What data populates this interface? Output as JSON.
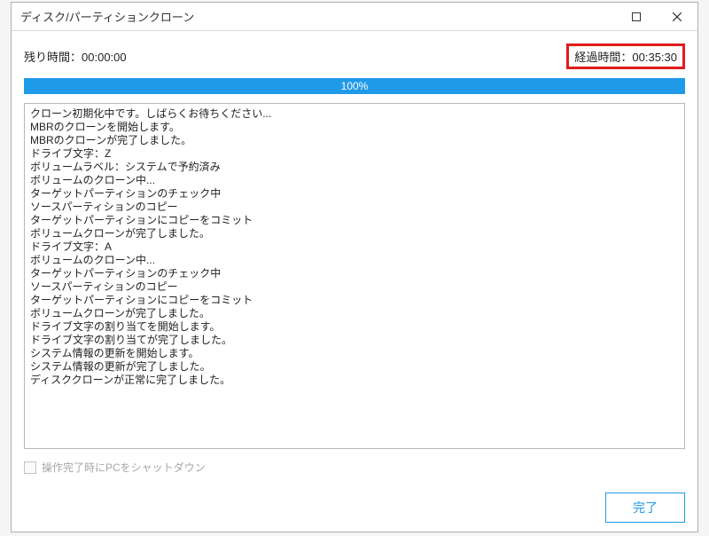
{
  "window": {
    "title": "ディスク/パーティションクローン"
  },
  "times": {
    "remaining_label": "残り時間：",
    "remaining_value": "00:00:00",
    "elapsed_label": "経過時間：",
    "elapsed_value": "00:35:30"
  },
  "progress": {
    "percent_text": "100%",
    "fill_pct": 100
  },
  "log_lines": [
    "クローン初期化中です。しばらくお待ちください...",
    "MBRのクローンを開始します。",
    "MBRのクローンが完了しました。",
    "ドライブ文字：Z",
    "ボリュームラベル：システムで予約済み",
    "ボリュームのクローン中...",
    "ターゲットパーティションのチェック中",
    "ソースパーティションのコピー",
    "ターゲットパーティションにコピーをコミット",
    "ボリュームクローンが完了しました。",
    "ドライブ文字：A",
    "ボリュームのクローン中...",
    "ターゲットパーティションのチェック中",
    "ソースパーティションのコピー",
    "ターゲットパーティションにコピーをコミット",
    "ボリュームクローンが完了しました。",
    "ドライブ文字の割り当てを開始します。",
    "ドライブ文字の割り当てが完了しました。",
    "システム情報の更新を開始します。",
    "システム情報の更新が完了しました。",
    "ディスククローンが正常に完了しました。"
  ],
  "shutdown_checkbox": {
    "label": "操作完了時にPCをシャットダウン",
    "checked": false
  },
  "buttons": {
    "done": "完了"
  }
}
